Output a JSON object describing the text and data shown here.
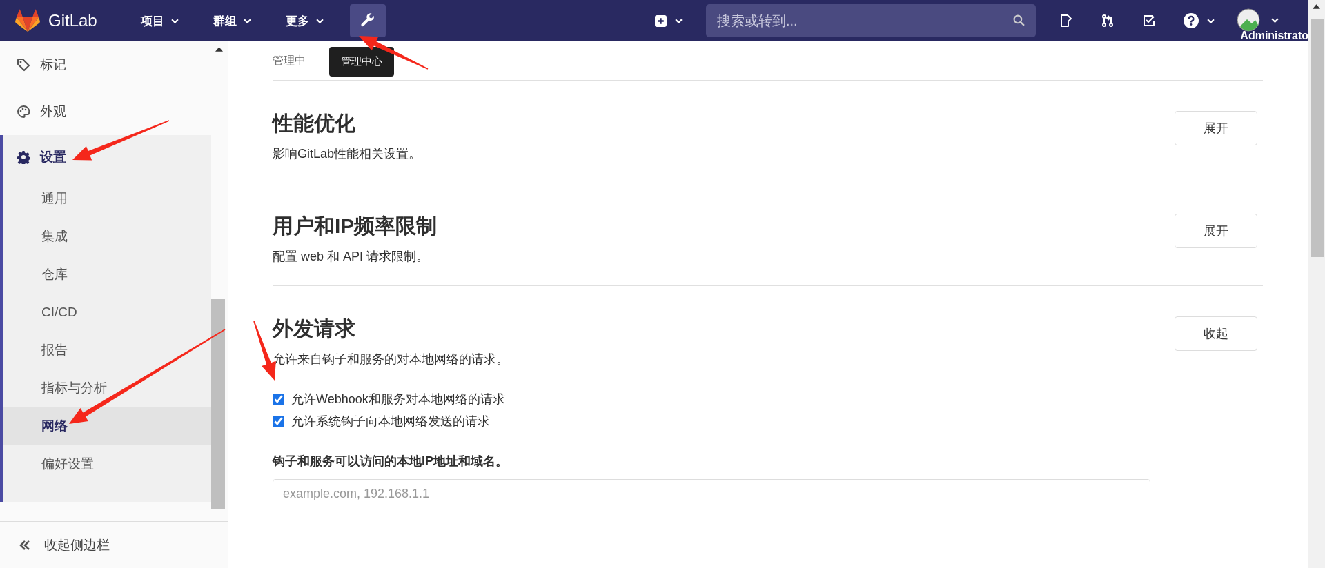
{
  "header": {
    "logo": "GitLab",
    "nav": [
      {
        "label": "项目"
      },
      {
        "label": "群组"
      },
      {
        "label": "更多"
      }
    ],
    "admin_tooltip": "管理中心",
    "search": {
      "placeholder": "搜索或转到..."
    },
    "user": "Administrato"
  },
  "breadcrumb": [
    "管理中"
  ],
  "sidebar": {
    "items": [
      {
        "label": "标记",
        "kind": "tag"
      },
      {
        "label": "外观",
        "kind": "palette"
      }
    ],
    "settings": {
      "label": "设置",
      "children": [
        {
          "label": "通用",
          "selected": false
        },
        {
          "label": "集成",
          "selected": false
        },
        {
          "label": "仓库",
          "selected": false
        },
        {
          "label": "CI/CD",
          "selected": false
        },
        {
          "label": "报告",
          "selected": false
        },
        {
          "label": "指标与分析",
          "selected": false
        },
        {
          "label": "网络",
          "selected": true
        },
        {
          "label": "偏好设置",
          "selected": false
        }
      ]
    },
    "collapse": "收起侧边栏"
  },
  "sections": [
    {
      "title": "性能优化",
      "description": "影响GitLab性能相关设置。",
      "button": "展开"
    },
    {
      "title": "用户和IP频率限制",
      "description": "配置 web 和 API 请求限制。",
      "button": "展开"
    },
    {
      "title": "外发请求",
      "description": "允许来自钩子和服务的对本地网络的请求。",
      "button": "收起",
      "checkboxes": [
        {
          "label": "允许Webhook和服务对本地网络的请求",
          "checked": true
        },
        {
          "label": "允许系统钩子向本地网络发送的请求",
          "checked": true
        }
      ],
      "field_label": "钩子和服务可以访问的本地IP地址和域名。",
      "field": {
        "placeholder": "example.com, 192.168.1.1"
      }
    }
  ]
}
